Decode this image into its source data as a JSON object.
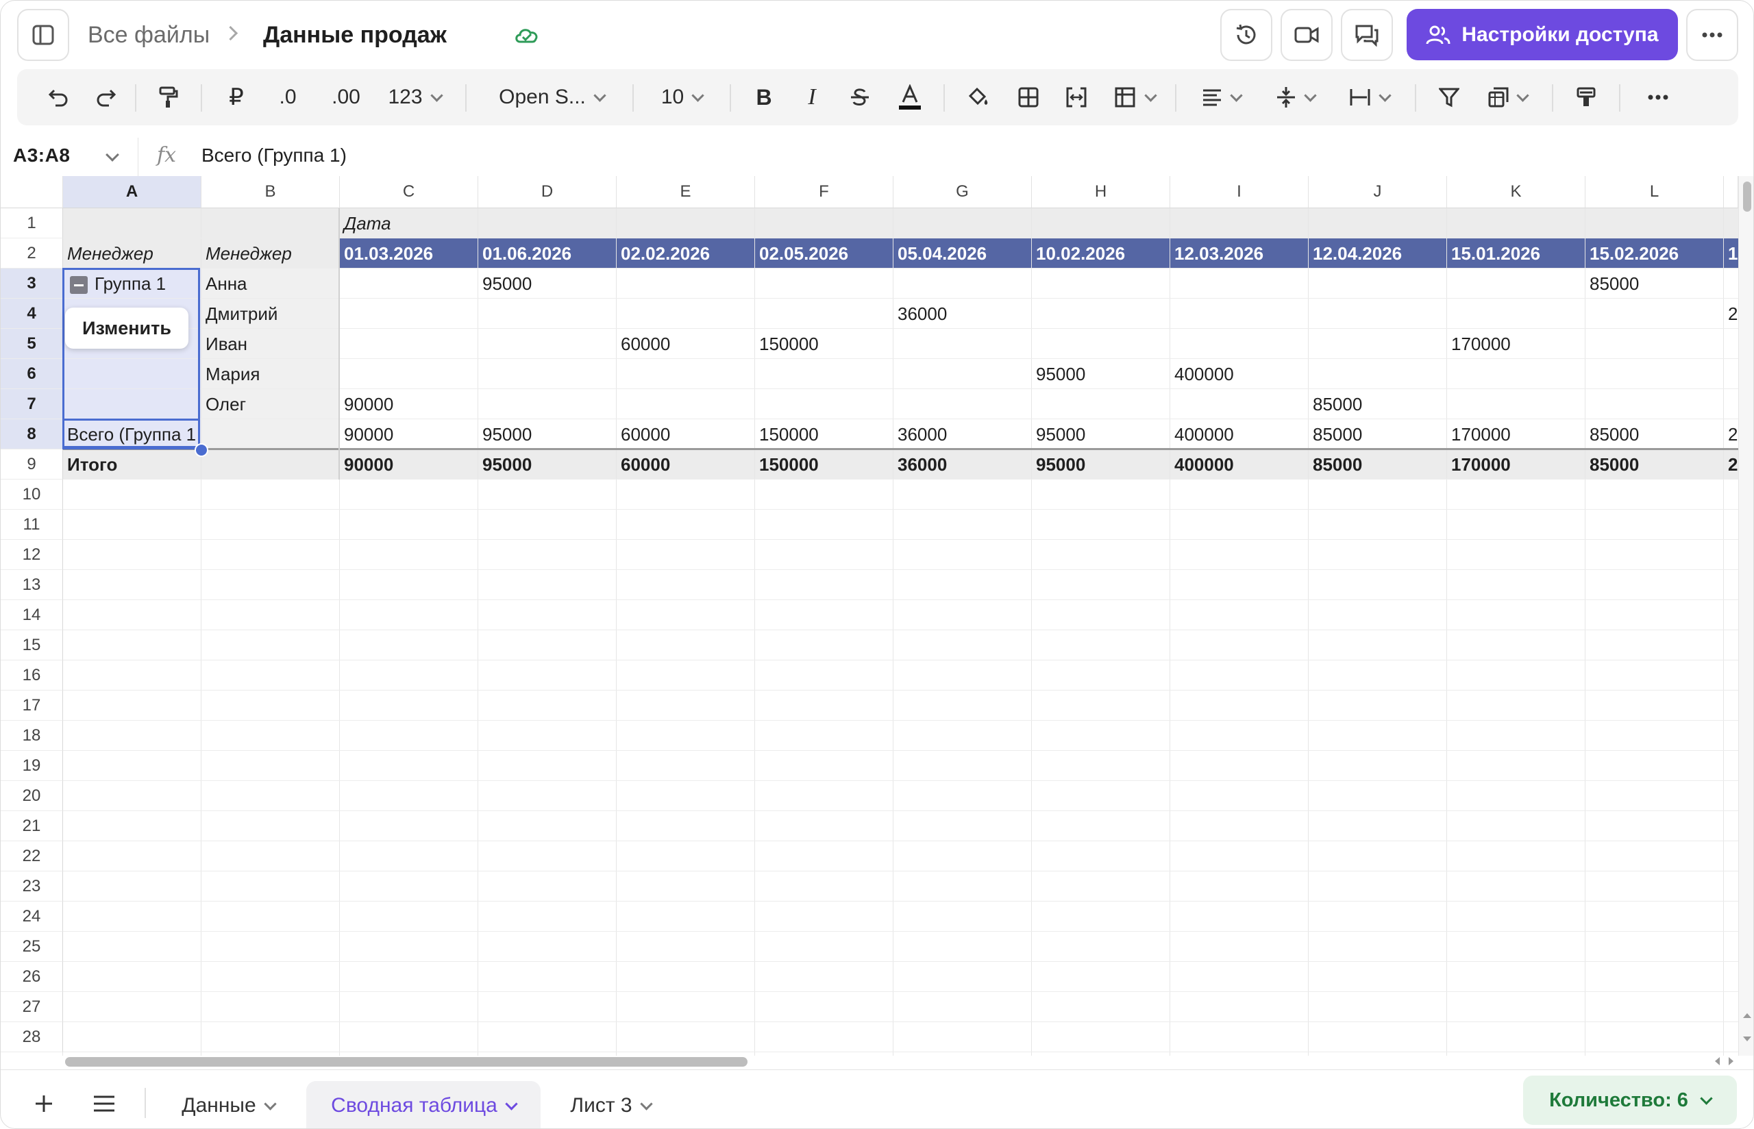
{
  "header": {
    "breadcrumb_root": "Все файлы",
    "file_title": "Данные продаж",
    "share_label": "Настройки доступа"
  },
  "toolbar": {
    "format_dec1": ".0",
    "format_dec2": ".00",
    "number_format": "123",
    "font_name": "Open S...",
    "font_size": "10"
  },
  "formula_bar": {
    "cell_ref": "A3:A8",
    "fx": "fx",
    "value": "Всего (Группа 1)"
  },
  "columns": [
    "A",
    "B",
    "C",
    "D",
    "E",
    "F",
    "G",
    "H",
    "I",
    "J",
    "K",
    "L"
  ],
  "selected_column": "A",
  "rows": [
    "1",
    "2",
    "3",
    "4",
    "5",
    "6",
    "7",
    "8",
    "9",
    "10",
    "11",
    "12",
    "13",
    "14",
    "15",
    "16",
    "17",
    "18",
    "19",
    "20",
    "21",
    "22",
    "23",
    "24",
    "25",
    "26",
    "27",
    "28"
  ],
  "selected_rows": [
    "3",
    "4",
    "5",
    "6",
    "7",
    "8"
  ],
  "pivot": {
    "date_label": "Дата",
    "row_header_a": "Менеджер",
    "row_header_b": "Менеджер",
    "dates": [
      "01.03.2026",
      "01.06.2026",
      "02.02.2026",
      "02.05.2026",
      "05.04.2026",
      "10.02.2026",
      "12.03.2026",
      "12.04.2026",
      "15.01.2026",
      "15.02.2026",
      "1"
    ],
    "group_label": "Группа 1",
    "managers": [
      "Анна",
      "Дмитрий",
      "Иван",
      "Мария",
      "Олег"
    ],
    "values": {
      "Анна": {
        "D": "95000",
        "L": "85000"
      },
      "Дмитрий": {
        "G": "36000",
        "M": "2"
      },
      "Иван": {
        "E": "60000",
        "F": "150000",
        "K": "170000"
      },
      "Мария": {
        "H": "95000",
        "I": "400000"
      },
      "Олег": {
        "C": "90000",
        "J": "85000"
      }
    },
    "subtotal_label": "Всего (Группа 1",
    "subtotals": [
      "90000",
      "95000",
      "60000",
      "150000",
      "36000",
      "95000",
      "400000",
      "85000",
      "170000",
      "85000",
      "2"
    ],
    "total_label": "Итого",
    "totals": [
      "90000",
      "95000",
      "60000",
      "150000",
      "36000",
      "95000",
      "400000",
      "85000",
      "170000",
      "85000",
      "2"
    ]
  },
  "edit_chip_label": "Изменить",
  "sheets": [
    {
      "label": "Данные",
      "active": false
    },
    {
      "label": "Сводная таблица",
      "active": true
    },
    {
      "label": "Лист 3",
      "active": false
    }
  ],
  "status_count": "Количество: 6",
  "colors": {
    "accent": "#6d4ae0",
    "pivot_header": "#5566a4",
    "pivot_band": "#ececec",
    "selection": "#e3e6f7",
    "selection_border": "#4a6cd0",
    "count_green": "#1e7a3a"
  }
}
